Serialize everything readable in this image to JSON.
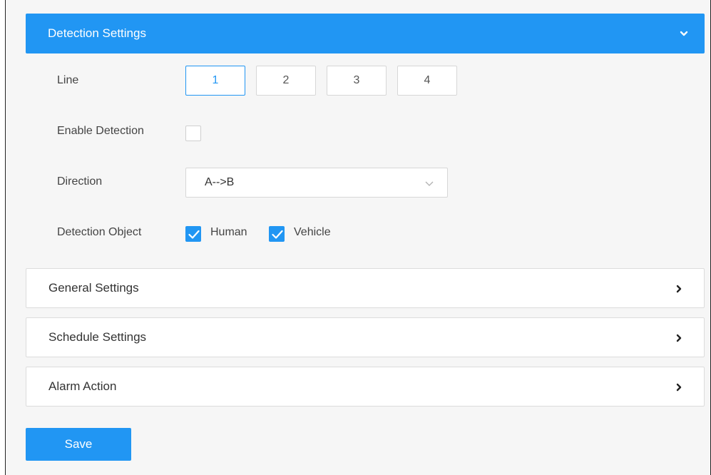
{
  "detection": {
    "header": "Detection Settings",
    "header_icon": "chevron-down-icon",
    "line_label": "Line",
    "lines": [
      "1",
      "2",
      "3",
      "4"
    ],
    "active_line": "1",
    "enable_label": "Enable Detection",
    "enable_checked": false,
    "direction_label": "Direction",
    "direction_value": "A-->B",
    "object_label": "Detection Object",
    "objects": [
      {
        "label": "Human",
        "checked": true
      },
      {
        "label": "Vehicle",
        "checked": true
      }
    ]
  },
  "sections": [
    {
      "label": "General Settings",
      "icon": "chevron-right-icon"
    },
    {
      "label": "Schedule Settings",
      "icon": "chevron-right-icon"
    },
    {
      "label": "Alarm Action",
      "icon": "chevron-right-icon"
    }
  ],
  "save_label": "Save",
  "colors": {
    "accent": "#2196f3",
    "background": "#f6f6f6"
  }
}
